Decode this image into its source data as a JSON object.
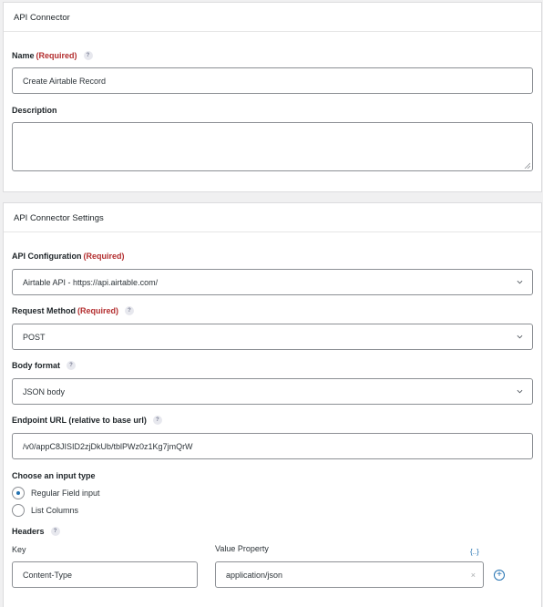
{
  "panel1": {
    "title": "API Connector",
    "name_label": "Name",
    "required_text": "(Required)",
    "help_glyph": "?",
    "name_value": "Create Airtable Record",
    "description_label": "Description",
    "description_value": ""
  },
  "panel2": {
    "title": "API Connector Settings",
    "api_config_label": "API Configuration",
    "api_config_value": "Airtable API - https://api.airtable.com/",
    "request_method_label": "Request Method",
    "request_method_value": "POST",
    "body_format_label": "Body format",
    "body_format_value": "JSON body",
    "endpoint_label": "Endpoint URL (relative to base url)",
    "endpoint_value": "/v0/appC8JISID2zjDkUb/tblPWz0z1Kg7jmQrW",
    "input_type_label": "Choose an input type",
    "input_types": [
      "Regular Field input",
      "List Columns"
    ],
    "headers_label": "Headers",
    "key_label": "Key",
    "value_label": "Value Property",
    "header_key": "Content-Type",
    "header_value": "application/json",
    "merge_tag_glyph": "{..}",
    "clear_glyph": "×",
    "add_glyph": "+"
  },
  "colors": {
    "required": "#b32d2e",
    "accent": "#2271b1",
    "border": "#8c8f94"
  }
}
